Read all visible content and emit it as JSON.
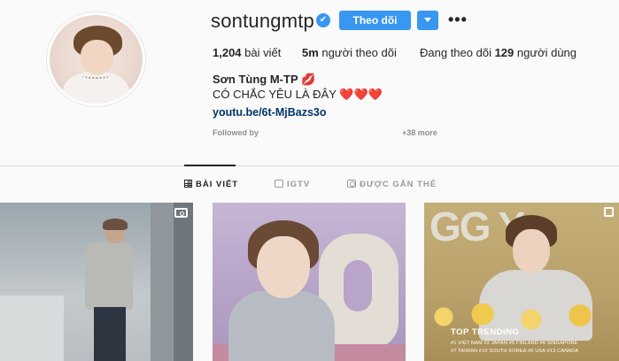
{
  "profile": {
    "username": "sontungmtp",
    "verified_badge": "✔",
    "follow_label": "Theo dõi",
    "more_label": "•••",
    "stats": [
      {
        "value": "1,204",
        "label": "bài viết"
      },
      {
        "value": "5m",
        "label": "người theo dõi"
      },
      {
        "prefix": "Đang theo dõi",
        "value": "129",
        "label": "người dùng"
      }
    ],
    "full_name": "Sơn Tùng M-TP 💋",
    "bio": "CÓ CHẮC YÊU LÀ ĐÂY ❤️❤️❤️",
    "link": "youtu.be/6t-MjBazs3o",
    "followed_by": "Followed by",
    "more_count": "+38 more"
  },
  "tabs": [
    {
      "label": "BÀI VIẾT",
      "icon": "grid-icon",
      "active": true
    },
    {
      "label": "IGTV",
      "icon": "igtv-icon",
      "active": false
    },
    {
      "label": "ĐƯỢC GẮN THẺ",
      "icon": "tagged-icon",
      "active": false
    }
  ],
  "posts": [
    {
      "type": "video"
    },
    {
      "type": "photo"
    },
    {
      "type": "carousel",
      "overlay_title": "TOP TRENDING",
      "overlay_lines": [
        "#1 VIỆT NAM  #2 JAPAN  #5 FINLAND  #6 SINGAPORE",
        "#7 TAIWAN  #10 SOUTH KOREA  #6 USA  #13 CANADA"
      ]
    }
  ],
  "colors": {
    "accent": "#3897f0",
    "link": "#003569",
    "muted": "#8e8e8e",
    "background": "#fafafa"
  }
}
